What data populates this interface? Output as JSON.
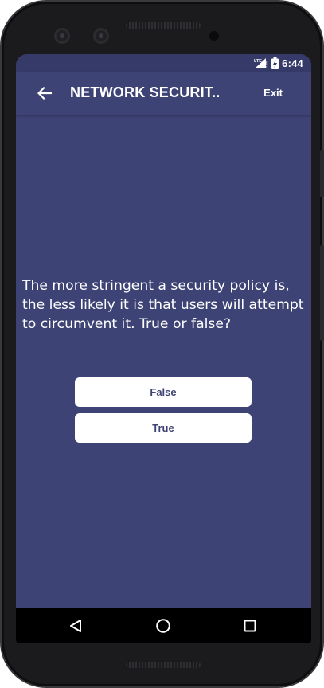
{
  "status_bar": {
    "network_label": "LTE",
    "time": "6:44"
  },
  "app_bar": {
    "title": "NETWORK SECURIT..",
    "exit_label": "Exit"
  },
  "quiz": {
    "question": "The more stringent a security policy is, the less likely it is that users will attempt to circumvent it.  True or false?",
    "answers": [
      {
        "label": "False"
      },
      {
        "label": "True"
      }
    ]
  },
  "colors": {
    "background": "#3e4375",
    "status_bar": "#353a68",
    "button_background": "#ffffff",
    "button_text": "#3e4375"
  },
  "icons": {
    "back": "arrow-left-icon",
    "signal": "cell-signal-icon",
    "battery": "battery-charging-icon",
    "nav_back": "triangle-back-icon",
    "nav_home": "circle-home-icon",
    "nav_recents": "square-recents-icon"
  }
}
